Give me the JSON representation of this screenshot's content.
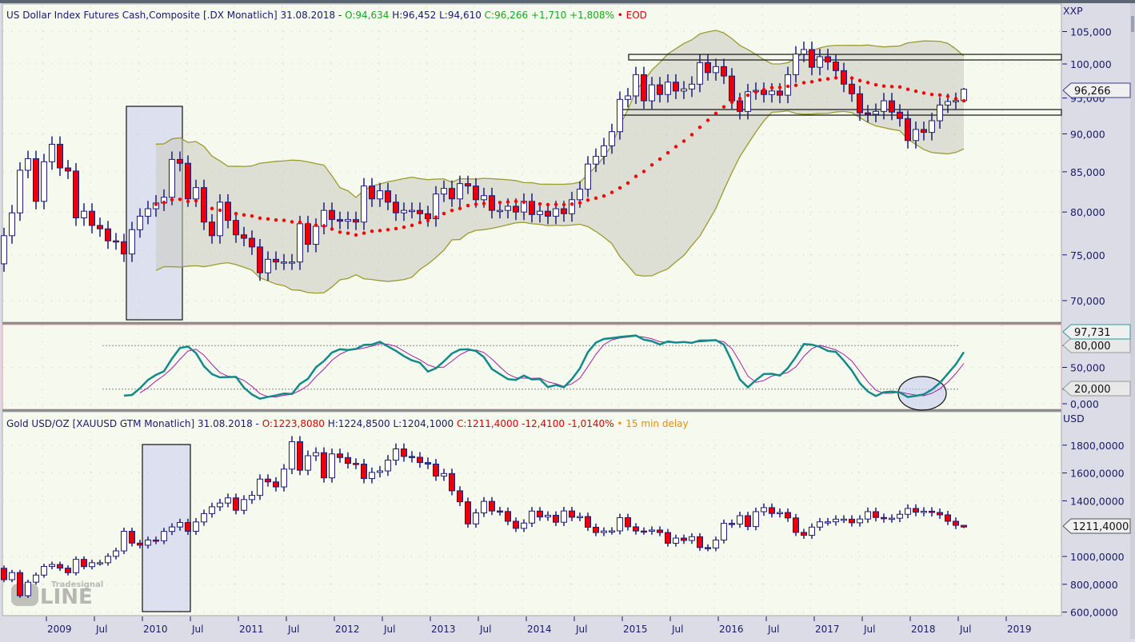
{
  "panels": {
    "dxy": {
      "name": "US Dollar Index Futures Cash,Composite [.DX Monatlich] 31.08.2018 -",
      "open": "O:94,634",
      "high": "H:96,452",
      "low": "L:94,610",
      "close": "C:96,266 +1,710 +1,808%",
      "status": "• EOD",
      "unit": "XXP",
      "last_tag": "96,266"
    },
    "stoch": {
      "last_tag": "97,731",
      "upper_tag": "80,000",
      "lower_tag": "20,000"
    },
    "gold": {
      "name": "Gold USD/OZ [XAUUSD GTM Monatlich] 31.08.2018 -",
      "open": "O:1223,8080",
      "high": "H:1224,8500",
      "low": "L:1204,1000",
      "close": "C:1211,4000 -12,4100 -1,0140%",
      "status": "• 15 min delay",
      "unit": "USD",
      "last_tag": "1211,4000"
    },
    "watermark": "Tradesignal online"
  },
  "colors": {
    "up": "#ffffff",
    "down": "#e8000b",
    "outline": "#1f1f7a",
    "band": "#9b9b2e",
    "sma": "#ff0000",
    "stoch_k": "#138a8a",
    "stoch_d": "#a020a0"
  },
  "chart_data": [
    {
      "type": "candlestick",
      "title": "US Dollar Index Futures Cash (.DX) monthly",
      "start": "2008-08",
      "closes": [
        77.2,
        79.9,
        85.2,
        86.7,
        81.3,
        86.3,
        88.6,
        85.5,
        85.1,
        79.3,
        80.1,
        78.4,
        78.0,
        76.6,
        76.5,
        75.1,
        77.9,
        79.5,
        80.4,
        81.1,
        81.8,
        86.6,
        86.1,
        81.6,
        83.0,
        78.8,
        77.2,
        81.2,
        79.0,
        77.3,
        76.9,
        75.9,
        73.0,
        74.5,
        74.2,
        74.2,
        74.2,
        78.6,
        76.2,
        78.3,
        80.2,
        79.1,
        78.9,
        79.1,
        78.8,
        83.2,
        81.6,
        82.6,
        81.2,
        79.9,
        80.2,
        80.2,
        79.8,
        79.2,
        82.2,
        82.9,
        81.6,
        83.5,
        83.2,
        81.5,
        82.0,
        80.2,
        80.2,
        80.7,
        80.0,
        81.3,
        79.7,
        80.1,
        79.5,
        80.4,
        79.8,
        81.5,
        82.8,
        86.0,
        87.0,
        88.4,
        90.3,
        94.8,
        95.3,
        98.4,
        94.6,
        96.9,
        95.5,
        97.3,
        96.0,
        96.3,
        97.0,
        100.2,
        98.7,
        99.6,
        98.2,
        94.6,
        93.1,
        95.9,
        96.1,
        95.5,
        96.0,
        95.4,
        98.4,
        101.5,
        102.2,
        99.5,
        101.1,
        100.3,
        99.0,
        97.0,
        95.6,
        92.9,
        92.7,
        93.1,
        94.6,
        93.0,
        92.1,
        89.1,
        90.6,
        90.2,
        91.8,
        94.0,
        94.5,
        94.634,
        96.266
      ],
      "first_open": 74.0,
      "last_bar": {
        "open": 94.634,
        "high": 96.452,
        "low": 94.61,
        "close": 96.266
      },
      "y_ticks": [
        70,
        75,
        80,
        85,
        90,
        95,
        100,
        105
      ],
      "y_tick_labels": [
        "70,000",
        "75,000",
        "80,000",
        "85,000",
        "90,000",
        "95,000",
        "100,000",
        "105,000"
      ],
      "overlays": [
        "Bollinger Bands (20, 2)",
        "SMA 20 (dotted)"
      ],
      "resistance_zones": [
        [
          100.6,
          101.5
        ],
        [
          92.8,
          93.6
        ]
      ]
    },
    {
      "type": "line",
      "title": "Stochastic",
      "series": [
        {
          "name": "%K"
        },
        {
          "name": "%D"
        }
      ],
      "levels": [
        20,
        80
      ],
      "y_ticks": [
        0,
        20,
        50,
        80
      ],
      "y_tick_labels": [
        "0,000",
        "20,000",
        "50,000",
        "80,000"
      ],
      "ylim": [
        0,
        100
      ]
    },
    {
      "type": "candlestick",
      "title": "Gold USD/OZ (XAUUSD) monthly",
      "start": "2008-08",
      "closes": [
        833,
        884,
        718,
        815,
        866,
        928,
        942,
        916,
        883,
        979,
        927,
        955,
        955,
        1001,
        1040,
        1181,
        1096,
        1081,
        1118,
        1113,
        1180,
        1212,
        1244,
        1181,
        1248,
        1308,
        1357,
        1384,
        1421,
        1332,
        1409,
        1439,
        1556,
        1536,
        1500,
        1628,
        1825,
        1620,
        1724,
        1746,
        1565,
        1737,
        1711,
        1669,
        1664,
        1560,
        1604,
        1615,
        1692,
        1773,
        1719,
        1713,
        1675,
        1664,
        1578,
        1596,
        1472,
        1393,
        1234,
        1313,
        1396,
        1327,
        1323,
        1253,
        1202,
        1240,
        1326,
        1284,
        1296,
        1246,
        1327,
        1282,
        1287,
        1210,
        1172,
        1183,
        1184,
        1279,
        1213,
        1183,
        1182,
        1190,
        1172,
        1095,
        1132,
        1115,
        1142,
        1064,
        1061,
        1118,
        1238,
        1233,
        1293,
        1215,
        1322,
        1351,
        1309,
        1316,
        1277,
        1173,
        1152,
        1211,
        1249,
        1249,
        1268,
        1268,
        1242,
        1269,
        1322,
        1280,
        1271,
        1275,
        1303,
        1345,
        1318,
        1325,
        1316,
        1299,
        1253,
        1223.8,
        1211.4
      ],
      "first_open": 915,
      "last_bar": {
        "open": 1223.808,
        "high": 1224.85,
        "low": 1204.1,
        "close": 1211.4
      },
      "y_ticks": [
        600,
        800,
        1000,
        1400,
        1600,
        1800
      ],
      "y_tick_labels": [
        "600,0000",
        "800,0000",
        "1000,0000",
        "1400,0000",
        "1600,0000",
        "1800,0000"
      ]
    }
  ],
  "time_axis": [
    "2009",
    "Jul",
    "2010",
    "Jul",
    "2011",
    "Jul",
    "2012",
    "Jul",
    "2013",
    "Jul",
    "2014",
    "Jul",
    "2015",
    "Jul",
    "2016",
    "Jul",
    "2017",
    "Jul",
    "2018",
    "Jul",
    "2019"
  ]
}
